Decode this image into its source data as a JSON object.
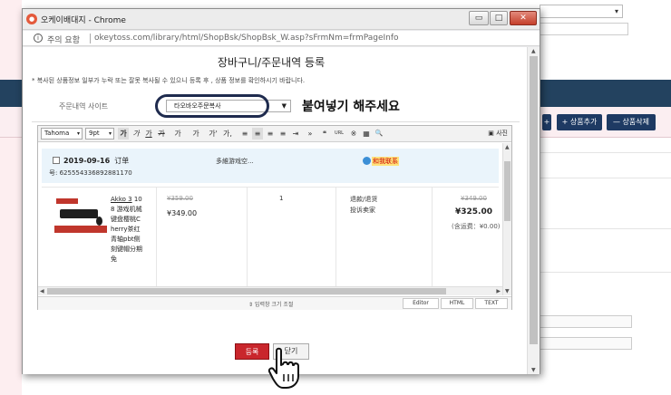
{
  "background": {
    "add_product_label": "+ 상품추가",
    "delete_product_label": "— 상품삭제",
    "first_button_label": "+"
  },
  "window": {
    "title": "오케이배대지 - Chrome",
    "minimize": "▭",
    "restore": "□",
    "close": "✕"
  },
  "addressbar": {
    "security_warning": "주의 요함",
    "url": "okeytoss.com/library/html/ShopBsk/ShopBsk_W.asp?sFrmNm=frmPageInfo"
  },
  "page": {
    "title": "장바구니/주문내역 등록",
    "notice": "* 복사된 상품정보 일부가 누락 또는 잘못 복사될 수 있으니 등록 후 , 상품 정보를 확인하시기 바랍니다.",
    "site_label": "주문내역 사이트",
    "site_selected": "타오바오주문복사",
    "paste_hint": "붙여넣기 해주세요"
  },
  "toolbar": {
    "font": "Tahoma",
    "size": "9pt",
    "bold": "가",
    "italic": "가",
    "underline": "가",
    "strike": "가",
    "text_color": "가",
    "bg_color": "가",
    "superscript": "가'",
    "subscript": "가,",
    "align_left": "≡",
    "align_center": "≡",
    "align_right": "≡",
    "justify": "≡",
    "indent": "⇥",
    "more": "»",
    "quote": "❝",
    "link": "URL",
    "special": "※",
    "table": "▦",
    "search": "🔍",
    "photo": "사진"
  },
  "order": {
    "date": "2019-09-16",
    "order_label": "订单",
    "order_number": "号: 625554336892881170",
    "shop_name": "多維游戏空...",
    "contact": "和我联系",
    "item_title_link": "Akko 3",
    "item_title_rest": "108 游戏机械键盘樱桃Cherry茶红青轴pbt侧刻键帽分期免",
    "original_price": "¥359.00",
    "price": "¥349.00",
    "quantity": "1",
    "refund_line1": "退款/退货",
    "refund_line2": "投诉卖家",
    "total_original": "¥349.00",
    "total": "¥325.00",
    "shipping": "(含运费：¥0.00)"
  },
  "editor_footer": {
    "resize_label": "⇕ 입력창 크기 조절",
    "tab_editor": "Editor",
    "tab_html": "HTML",
    "tab_text": "TEXT"
  },
  "buttons": {
    "submit": "등록",
    "close": "닫기"
  }
}
